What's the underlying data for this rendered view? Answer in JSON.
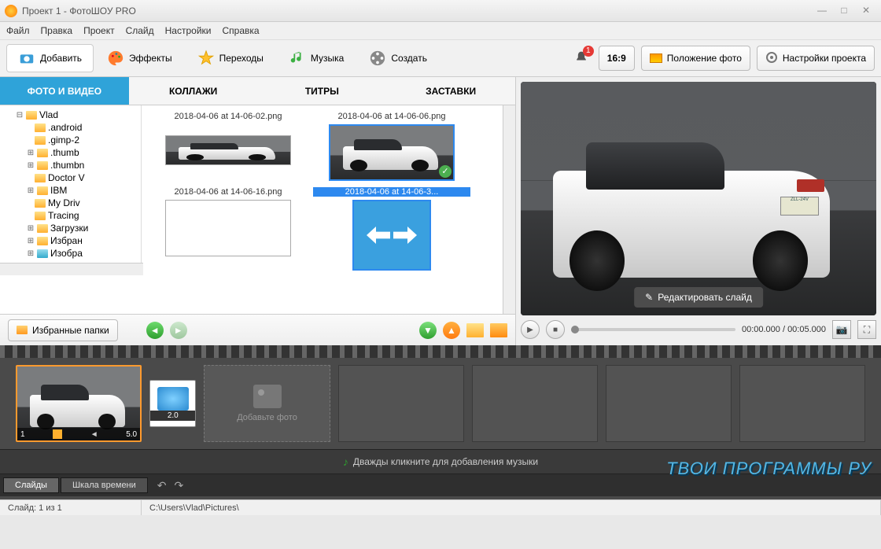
{
  "window": {
    "title": "Проект 1 - ФотоШОУ PRO"
  },
  "menu": {
    "file": "Файл",
    "edit": "Правка",
    "project": "Проект",
    "slide": "Слайд",
    "settings": "Настройки",
    "help": "Справка"
  },
  "main_tabs": {
    "add": "Добавить",
    "effects": "Эффекты",
    "transitions": "Переходы",
    "music": "Музыка",
    "create": "Создать"
  },
  "toolbar_right": {
    "notifications_count": "1",
    "aspect": "16:9",
    "photo_position": "Положение фото",
    "project_settings": "Настройки проекта"
  },
  "sub_tabs": {
    "photo_video": "ФОТО И ВИДЕО",
    "collages": "КОЛЛАЖИ",
    "titles": "ТИТРЫ",
    "intros": "ЗАСТАВКИ"
  },
  "tree": {
    "root": "Vlad",
    "items": [
      ".android",
      ".gimp-2",
      ".thumb",
      ".thumbn",
      "Doctor V",
      "IBM",
      "My Driv",
      "Tracing",
      "Загрузки",
      "Избран",
      "Изобра"
    ]
  },
  "files": [
    {
      "name": "2018-04-06 at 14-06-02.png",
      "kind": "car_wide",
      "selected": false
    },
    {
      "name": "2018-04-06 at 14-06-06.png",
      "kind": "car",
      "selected": true,
      "checked": true
    },
    {
      "name": "2018-04-06 at 14-06-16.png",
      "kind": "blank",
      "selected": false
    },
    {
      "name": "2018-04-06 at 14-06-3...",
      "kind": "arrows",
      "selected": true,
      "name_selected": true
    }
  ],
  "browser_footer": {
    "favorites": "Избранные папки"
  },
  "preview": {
    "plate_text": "ZLL-24V",
    "edit_slide": "Редактировать слайд",
    "time_current": "00:00.000",
    "time_total": "00:05.000",
    "time_sep": " / "
  },
  "timeline": {
    "slide_number": "1",
    "slide_duration": "5.0",
    "transition_duration": "2.0",
    "placeholder_text": "Добавьте фото",
    "music_hint": "Дважды кликните для добавления музыки"
  },
  "bottom_tabs": {
    "slides": "Слайды",
    "timeline": "Шкала времени"
  },
  "status": {
    "slide_counter": "Слайд: 1 из 1",
    "path": "C:\\Users\\Vlad\\Pictures\\"
  },
  "watermark": "ТВОИ ПРОГРАММЫ РУ"
}
